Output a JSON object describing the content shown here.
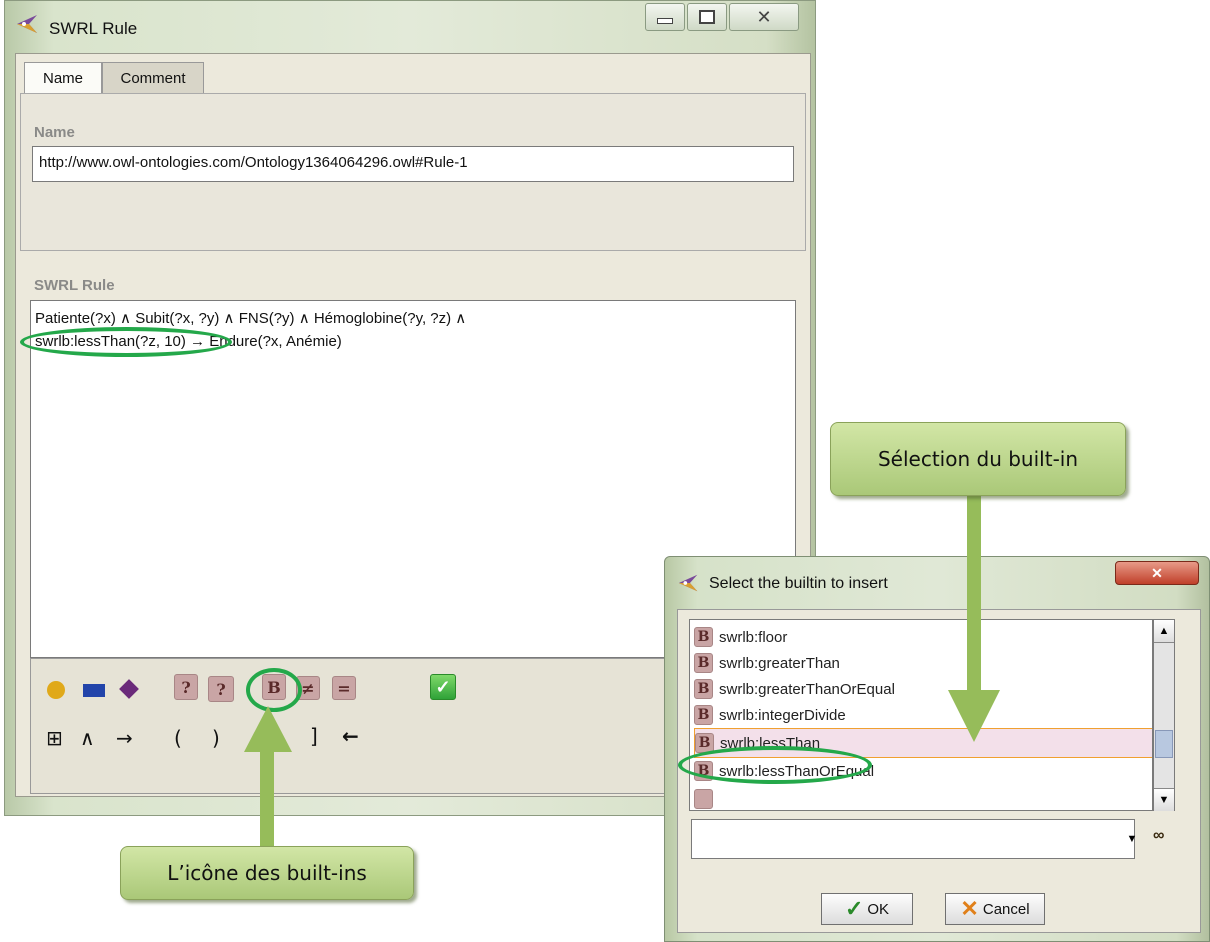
{
  "main_window": {
    "title": "SWRL Rule",
    "tabs": [
      {
        "label": "Name"
      },
      {
        "label": "Comment"
      }
    ],
    "name_label": "Name",
    "name_value": "http://www.owl-ontologies.com/Ontology1364064296.owl#Rule-1",
    "rule_label": "SWRL Rule",
    "rule_line1": "Patiente(?x) ∧ Subit(?x, ?y) ∧ FNS(?y) ∧ Hémoglobine(?y, ?z) ∧",
    "rule_line2_builtin": "swrlb:lessThan(?z, 10)",
    "rule_line2_rest": " → Endure(?x, Anémie)",
    "toolbar_row2": {
      "table": "⊞",
      "and": "∧",
      "implies": "→",
      "lparen": "(",
      "rparen": ")",
      "lbracket": "[",
      "rbracket": "]",
      "backspace": "←"
    },
    "toolbar_row1": {
      "builtin": "B",
      "different": "≠",
      "same": "="
    }
  },
  "dialog": {
    "title": "Select the builtin to insert",
    "items": [
      {
        "label": "swrlb:floor"
      },
      {
        "label": "swrlb:greaterThan"
      },
      {
        "label": "swrlb:greaterThanOrEqual"
      },
      {
        "label": "swrlb:integerDivide"
      },
      {
        "label": "swrlb:lessThan"
      },
      {
        "label": "swrlb:lessThanOrEqual"
      }
    ],
    "selected_index": 4,
    "badge": "B",
    "search_value": "",
    "ok_label": "OK",
    "cancel_label": "Cancel"
  },
  "callouts": {
    "builtin_selection": "Sélection du built-in",
    "builtin_icon": "L’icône des built-ins"
  },
  "colors": {
    "callout_fill": "#b9d48c",
    "highlight_green": "#24a84a",
    "arrow_green": "#96bc5a",
    "selection_border": "#f0a030"
  }
}
